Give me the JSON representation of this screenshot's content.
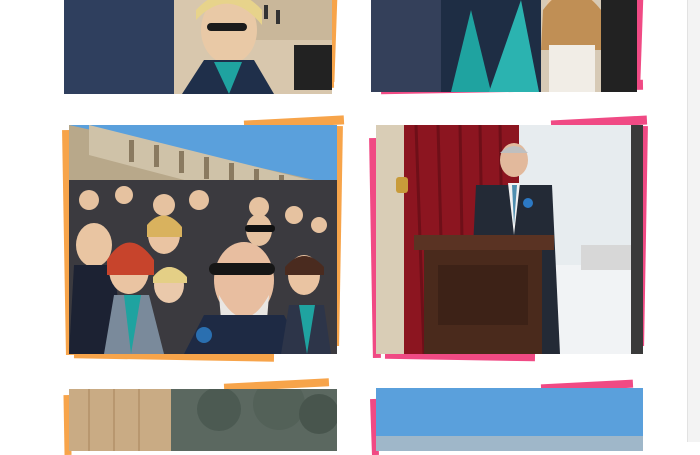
{
  "page": {
    "title": ""
  },
  "colors": {
    "accent_orange": "#f7a44a",
    "accent_pink": "#f04a84",
    "sky": "#5aa0dc",
    "stone": "#cfc2a8",
    "curtain": "#8c1520",
    "podium": "#4a2a1c",
    "teal_scarf": "#1fa3a0"
  },
  "gallery": {
    "photos": [
      {
        "alt": "selfie-group-top-left",
        "accent": "orange"
      },
      {
        "alt": "group-top-right",
        "accent": "pink"
      },
      {
        "alt": "ceremony-crowd-selfie",
        "accent": "orange"
      },
      {
        "alt": "speaker-at-podium",
        "accent": "pink"
      },
      {
        "alt": "bottom-left-partial",
        "accent": "orange"
      },
      {
        "alt": "bottom-right-partial",
        "accent": "pink"
      }
    ]
  }
}
